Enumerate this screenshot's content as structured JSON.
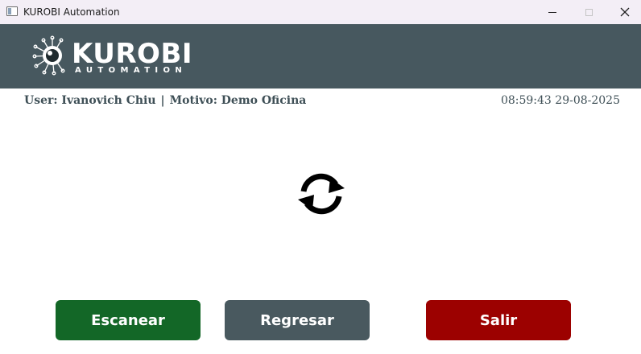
{
  "window": {
    "title": "KUROBI Automation",
    "controls": {
      "minimize_icon": "minimize-icon",
      "maximize_icon": "maximize-icon",
      "close_icon": "close-icon"
    }
  },
  "header": {
    "logo_name": "KUROBI",
    "logo_sub": "AUTOMATION",
    "background": "#47585f"
  },
  "info": {
    "user_label": "User: Ivanovich Chiu",
    "separator": "|",
    "reason_label": "Motivo: Demo Oficina",
    "datetime": "08:59:43 29-08-2025"
  },
  "main": {
    "status_icon": "refresh-icon"
  },
  "buttons": {
    "scan": {
      "label": "Escanear",
      "color": "#136727"
    },
    "back": {
      "label": "Regresar",
      "color": "#49595f"
    },
    "exit": {
      "label": "Salir",
      "color": "#9c0100"
    }
  }
}
